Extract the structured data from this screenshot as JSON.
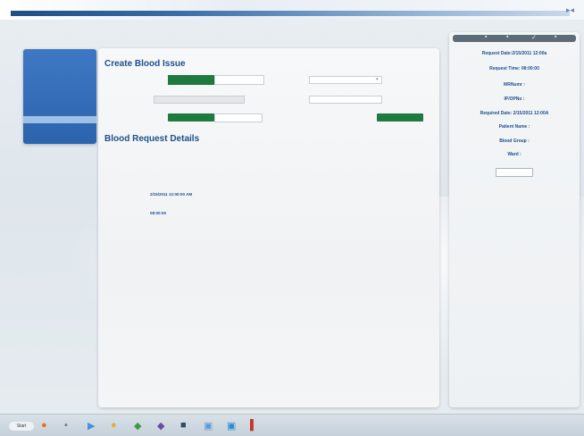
{
  "colors": {
    "accent": "#1e4f8a",
    "green": "#1f7a3f",
    "menu_blue": "#2c63ad"
  },
  "left_menu": {
    "items": [
      "",
      "",
      "",
      "",
      "",
      "",
      "",
      "",
      "",
      "",
      ""
    ],
    "active_index": 8
  },
  "main": {
    "title": "Create Blood Issue",
    "form": {
      "row1_label": "",
      "toggle_on": "",
      "toggle_off": "",
      "field_label": "",
      "field_value": "",
      "select1_label": "",
      "select1_value": "",
      "select2_label": "",
      "select2_value": "",
      "btn1": "",
      "btn2": "",
      "btn3": ""
    },
    "details_title": "Blood Request Details",
    "details": {
      "l1": "",
      "r1": "",
      "l2": "",
      "r2": "",
      "l3": "",
      "v3": "2/15/2011 12:00:00 AM",
      "r3": "",
      "l4": "",
      "v4": "08:00:00",
      "r4": ""
    }
  },
  "right_panel": {
    "toolbar_icons": [
      "save-icon",
      "print-icon",
      "check-icon",
      "settings-icon"
    ],
    "request_date": "Request Date:2/15/2011 12:00a",
    "request_time": "Request Time: 08:00:00",
    "mrno": "MRNumr :",
    "ipno": "IP/OPNo :",
    "required_date": "Required Date: 2/15/2011 12:00A",
    "patient_name": "Patient Name :",
    "blood_group": "Blood Group :",
    "ward": "Ward :",
    "button": ""
  },
  "taskbar": {
    "start": "Start",
    "icons": [
      "ie-icon",
      "folder-icon",
      "media-icon",
      "paint-icon",
      "vs-icon",
      "app-icon",
      "window-icon",
      "network-icon",
      "app-icon-2",
      "app-icon-3"
    ],
    "tray": ""
  }
}
